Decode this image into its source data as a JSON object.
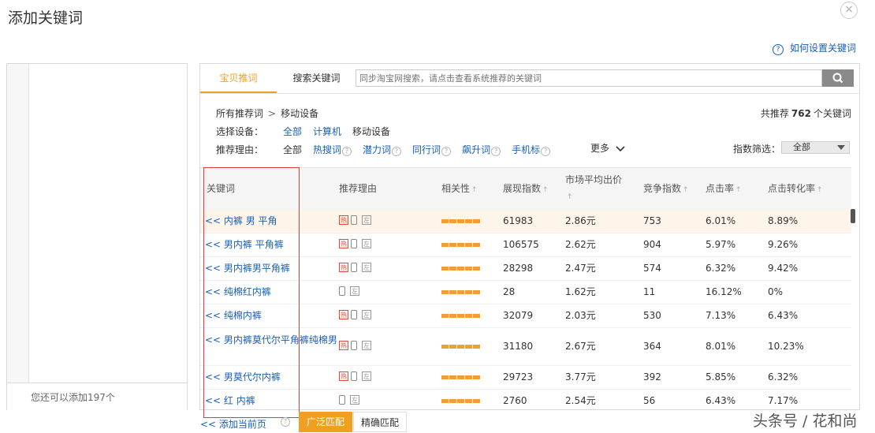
{
  "dialog": {
    "title": "添加关键词",
    "close_glyph": "×"
  },
  "help": {
    "q": "?",
    "label": "如何设置关键词"
  },
  "left_panel": {
    "remaining": "您还可以添加197个"
  },
  "tabs": {
    "active": "宝贝推词",
    "inactive": "搜索关键词"
  },
  "search": {
    "placeholder": "同步淘宝网搜索，请点击查看系统推荐的关键词"
  },
  "crumb": {
    "root": "所有推荐词",
    "sep": ">",
    "current": "移动设备"
  },
  "total": {
    "prefix": "共推荐",
    "count": "762",
    "suffix": "个关键词"
  },
  "device": {
    "label": "选择设备：",
    "options": [
      "全部",
      "计算机",
      "移动设备"
    ]
  },
  "reason": {
    "label": "推荐理由：",
    "options": [
      "全部",
      "热搜词",
      "潜力词",
      "同行词",
      "飙升词",
      "手机标"
    ],
    "q": "?"
  },
  "more": "更多",
  "idx": {
    "label": "指数筛选：",
    "value": "全部"
  },
  "columns": {
    "keyword": "关键词",
    "reason": "推荐理由",
    "relevance": "相关性",
    "show": "展现指数",
    "price": "市场平均出价",
    "comp": "竞争指数",
    "ctr": "点击率",
    "cvr": "点击转化率",
    "sort_arrow": "🠅"
  },
  "badges": {
    "hot": "热",
    "left": "左"
  },
  "rows": [
    {
      "kw": "<< 内裤 男 平角",
      "show": "61983",
      "price": "2.86元",
      "comp": "753",
      "ctr": "6.01%",
      "cvr": "8.89%",
      "hot": true
    },
    {
      "kw": "<< 男内裤 平角裤",
      "show": "106575",
      "price": "2.62元",
      "comp": "904",
      "ctr": "5.97%",
      "cvr": "9.26%",
      "hot": true
    },
    {
      "kw": "<< 男内裤男平角裤",
      "show": "28298",
      "price": "2.47元",
      "comp": "574",
      "ctr": "6.32%",
      "cvr": "9.42%",
      "hot": true
    },
    {
      "kw": "<< 纯棉红内裤",
      "show": "28",
      "price": "1.62元",
      "comp": "11",
      "ctr": "16.12%",
      "cvr": "0%",
      "hot": false
    },
    {
      "kw": "<< 纯棉内裤",
      "show": "32079",
      "price": "2.03元",
      "comp": "530",
      "ctr": "7.13%",
      "cvr": "6.43%",
      "hot": true
    },
    {
      "kw": "<< 男内裤莫代尔平角裤纯棉男",
      "show": "31180",
      "price": "2.67元",
      "comp": "364",
      "ctr": "8.01%",
      "cvr": "10.23%",
      "hot": true
    },
    {
      "kw": "<< 男莫代尔内裤",
      "show": "29723",
      "price": "3.77元",
      "comp": "392",
      "ctr": "5.85%",
      "cvr": "6.32%",
      "hot": true
    },
    {
      "kw": "<< 红 内裤",
      "show": "2760",
      "price": "2.54元",
      "comp": "56",
      "ctr": "6.43%",
      "cvr": "7.17%",
      "hot": false
    }
  ],
  "bottom": {
    "add_page": "<<  添加当前页",
    "q": "?",
    "broad": "广泛匹配",
    "exact": "精确匹配"
  },
  "watermark": "头条号 / 花和尚",
  "colors": {
    "accent": "#f0a020",
    "link": "#1a5fb4",
    "highlight_box": "#e03a3a"
  }
}
